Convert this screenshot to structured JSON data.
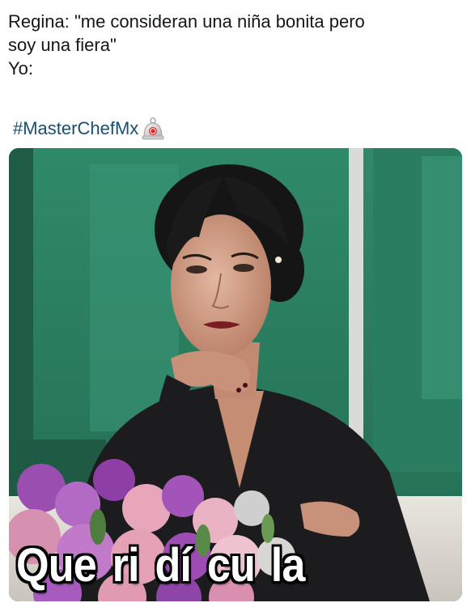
{
  "tweet": {
    "lines": [
      "Regina: \"me consideran una niña bonita pero",
      "soy una fiera\"",
      "Yo:"
    ],
    "hashtag": "#MasterChefMx",
    "hashflag_icon": "masterchef-bell-icon",
    "hashtag_color": "#1b4f6e"
  },
  "media": {
    "caption_words": [
      "Que",
      "ri",
      "dí",
      "cu",
      "la"
    ]
  }
}
